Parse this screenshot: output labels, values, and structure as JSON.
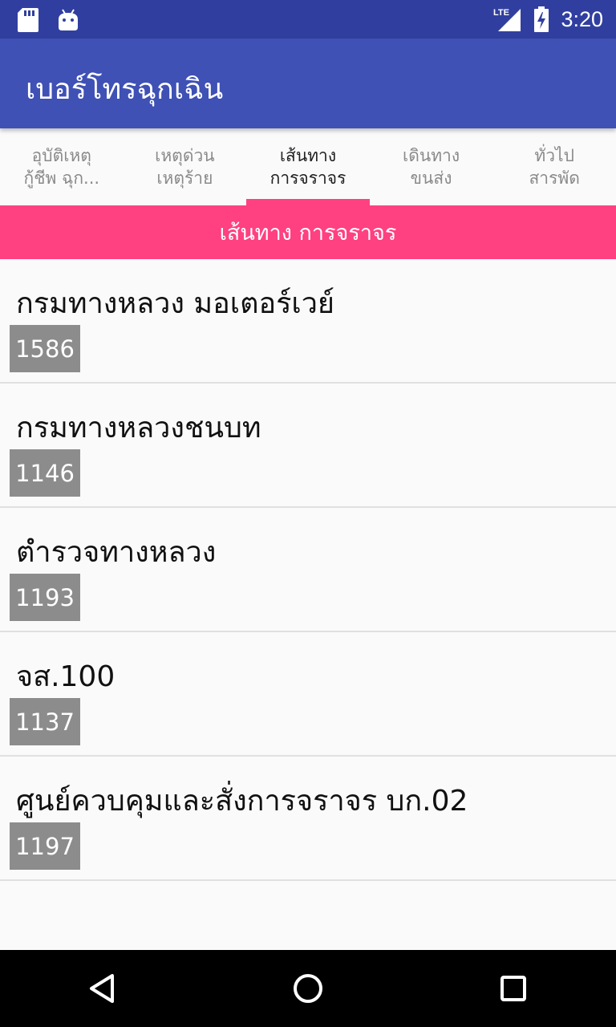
{
  "status_bar": {
    "time": "3:20",
    "network": "LTE",
    "icons": [
      "sd-card-icon",
      "android-icon",
      "signal-icon",
      "battery-charging-icon"
    ]
  },
  "app_bar": {
    "title": "เบอร์โทรฉุกเฉิน"
  },
  "tabs": [
    {
      "line1": "อุบัติเหตุ",
      "line2": "กู้ชีพ ฉุก...",
      "active": false
    },
    {
      "line1": "เหตุด่วน",
      "line2": "เหตุร้าย",
      "active": false
    },
    {
      "line1": "เส้นทาง",
      "line2": "การจราจร",
      "active": true
    },
    {
      "line1": "เดินทาง",
      "line2": "ขนส่ง",
      "active": false
    },
    {
      "line1": "ทั่วไป",
      "line2": "สารพัด",
      "active": false
    }
  ],
  "section_header": "เส้นทาง การจราจร",
  "items": [
    {
      "name": "กรมทางหลวง มอเตอร์เวย์",
      "number": "1586"
    },
    {
      "name": "กรมทางหลวงชนบท",
      "number": "1146"
    },
    {
      "name": "ตำรวจทางหลวง",
      "number": "1193"
    },
    {
      "name": "จส.100",
      "number": "1137"
    },
    {
      "name": "ศูนย์ควบคุมและสั่งการจราจร บก.02",
      "number": "1197"
    }
  ],
  "colors": {
    "status_bar": "#303f9f",
    "app_bar": "#3f51b5",
    "accent": "#ff4081",
    "number_badge": "#8c8c8c"
  }
}
